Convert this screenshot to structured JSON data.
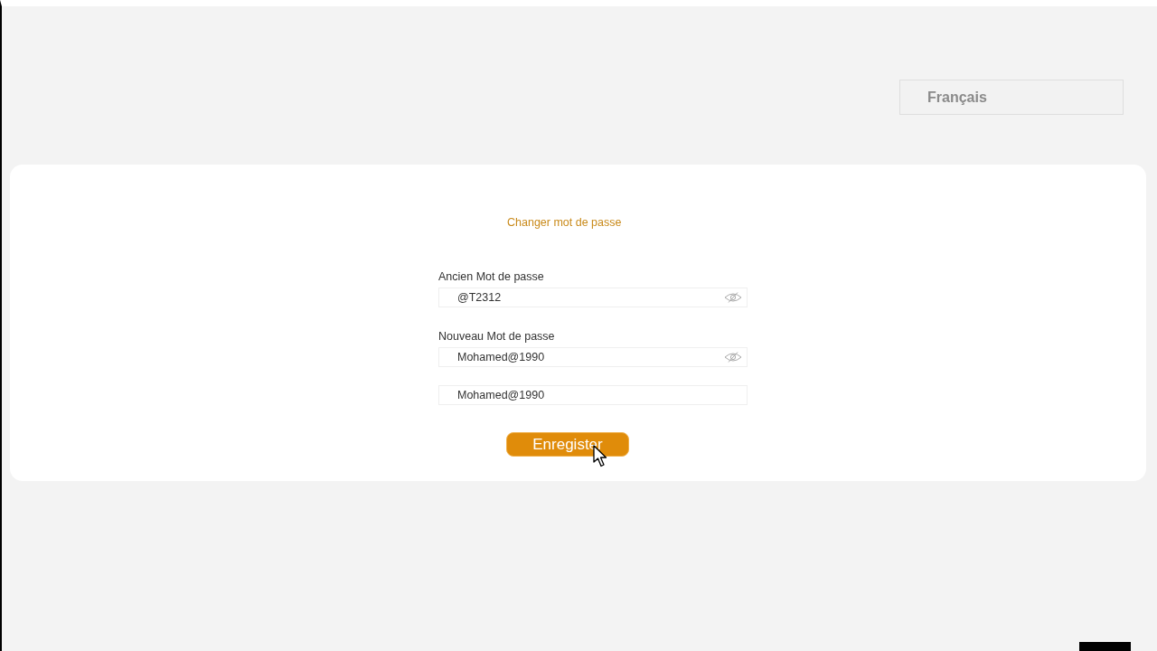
{
  "language_selector": {
    "value": "Français"
  },
  "form": {
    "title": "Changer mot de passe",
    "fields": [
      {
        "label": "Ancien Mot de passe",
        "value": "@T2312",
        "kind": "toggle"
      },
      {
        "label": "Nouveau Mot de passe",
        "value": "Mohamed@1990",
        "kind": "toggle"
      },
      {
        "value": "Mohamed@1990",
        "kind": "plain"
      }
    ],
    "submit": "Enregister"
  }
}
